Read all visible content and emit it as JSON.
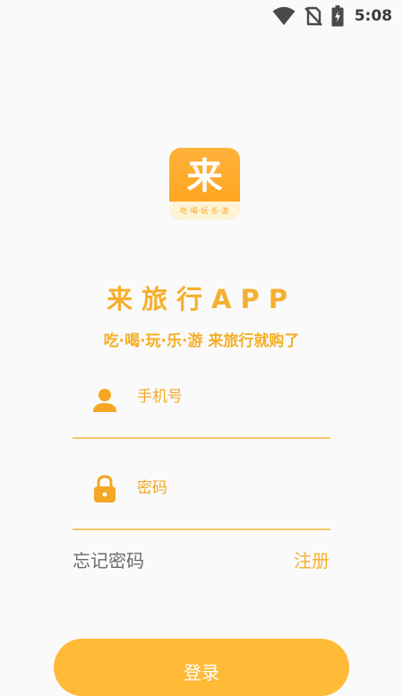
{
  "status_bar": {
    "time": "5:08",
    "icons": [
      "wifi-icon",
      "no-sim-icon",
      "battery-charging-icon"
    ]
  },
  "logo": {
    "char": "来",
    "tagline": "吃·喝·玩·乐·游"
  },
  "app": {
    "title": "来旅行APP",
    "slogan": "吃·喝·玩·乐·游 来旅行就购了"
  },
  "form": {
    "phone_placeholder": "手机号",
    "phone_icon": "user-icon",
    "password_placeholder": "密码",
    "password_icon": "lock-icon"
  },
  "links": {
    "forgot_password": "忘记密码",
    "register": "注册"
  },
  "login_button": "登录",
  "colors": {
    "accent": "#f5b030",
    "button": "#ffba38",
    "background": "#fafafa"
  }
}
